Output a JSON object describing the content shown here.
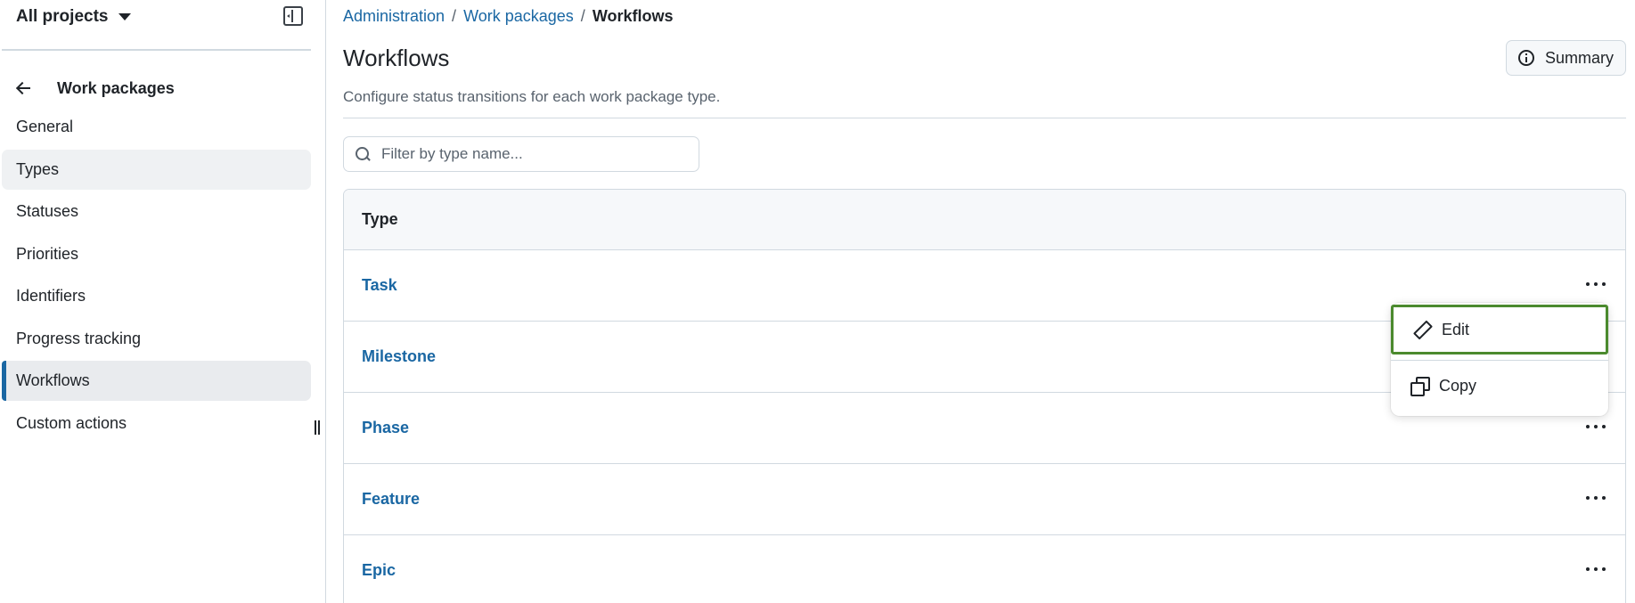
{
  "sidebar": {
    "project_selector": "All projects",
    "back_title": "Work packages",
    "items": [
      {
        "label": "General"
      },
      {
        "label": "Types"
      },
      {
        "label": "Statuses"
      },
      {
        "label": "Priorities"
      },
      {
        "label": "Identifiers"
      },
      {
        "label": "Progress tracking"
      },
      {
        "label": "Workflows"
      },
      {
        "label": "Custom actions"
      }
    ],
    "active_item": "Workflows"
  },
  "breadcrumb": {
    "items": [
      "Administration",
      "Work packages"
    ],
    "current": "Workflows"
  },
  "page": {
    "title": "Workflows",
    "summary_label": "Summary",
    "subtitle": "Configure status transitions for each work package type."
  },
  "filter": {
    "placeholder": "Filter by type name...",
    "value": ""
  },
  "table": {
    "header": "Type",
    "rows": [
      {
        "name": "Task"
      },
      {
        "name": "Milestone"
      },
      {
        "name": "Phase"
      },
      {
        "name": "Feature"
      },
      {
        "name": "Epic"
      }
    ]
  },
  "dropdown": {
    "items": [
      {
        "label": "Edit",
        "icon": "pencil-icon"
      },
      {
        "label": "Copy",
        "icon": "copy-icon"
      }
    ]
  },
  "colors": {
    "link": "#1a67a3",
    "focus_outline": "#4b8a2e",
    "active_indicator": "#1a67a3"
  }
}
